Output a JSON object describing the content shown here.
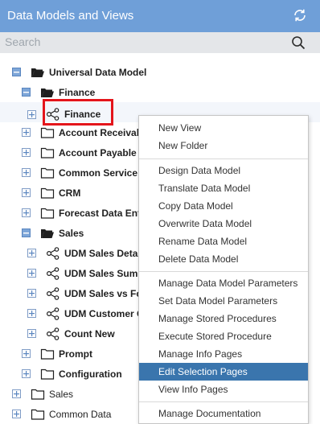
{
  "header": {
    "title": "Data Models and Views",
    "refresh_icon": "refresh-icon"
  },
  "search": {
    "placeholder": "Search",
    "icon": "search-icon"
  },
  "tree": {
    "root": {
      "label": "Universal Data Model"
    },
    "finance": {
      "label": "Finance"
    },
    "finance_model": {
      "label": "Finance"
    },
    "account_receivable": {
      "label": "Account Receivable"
    },
    "account_payable": {
      "label": "Account Payable"
    },
    "common_service": {
      "label": "Common Service"
    },
    "crm": {
      "label": "CRM"
    },
    "forecast": {
      "label": "Forecast Data Entry"
    },
    "sales": {
      "label": "Sales"
    },
    "udm_sales_details": {
      "label": "UDM Sales Details"
    },
    "udm_sales_summary": {
      "label": "UDM Sales Summary"
    },
    "udm_sales_vs_forecast": {
      "label": "UDM Sales vs Forecast"
    },
    "udm_customer": {
      "label": "UDM Customer Orders"
    },
    "count_new": {
      "label": "Count New"
    },
    "prompt": {
      "label": "Prompt"
    },
    "configuration": {
      "label": "Configuration"
    },
    "top_sales": {
      "label": "Sales"
    },
    "common_data": {
      "label": "Common Data"
    }
  },
  "context_menu": {
    "new_view": "New View",
    "new_folder": "New Folder",
    "design_data_model": "Design Data Model",
    "translate_data_model": "Translate Data Model",
    "copy_data_model": "Copy Data Model",
    "overwrite_data_model": "Overwrite Data Model",
    "rename_data_model": "Rename Data Model",
    "delete_data_model": "Delete Data Model",
    "manage_parameters": "Manage Data Model Parameters",
    "set_parameters": "Set Data Model Parameters",
    "manage_stored_procedures": "Manage Stored Procedures",
    "execute_stored_procedure": "Execute Stored Procedure",
    "manage_info_pages": "Manage Info Pages",
    "edit_selection_pages": "Edit Selection Pages",
    "view_info_pages": "View Info Pages",
    "manage_documentation": "Manage Documentation",
    "active_item": "Edit Selection Pages"
  },
  "colors": {
    "header": "#6f9fd8",
    "search_bg": "#e4e6e9",
    "menu_highlight": "#3a75ad",
    "callout": "#e4151b"
  }
}
